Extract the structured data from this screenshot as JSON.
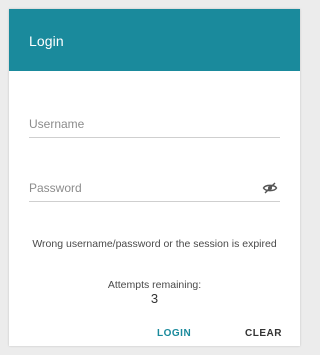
{
  "header": {
    "title": "Login",
    "background": "#1a8a9c"
  },
  "form": {
    "username": {
      "placeholder": "Username",
      "value": ""
    },
    "password": {
      "placeholder": "Password",
      "value": "",
      "toggle_icon": "eye-slash-icon"
    }
  },
  "message": {
    "error": "Wrong username/password or the session is expired",
    "attempts_label": "Attempts remaining:",
    "attempts_count": "3"
  },
  "actions": {
    "login_label": "LOGIN",
    "clear_label": "CLEAR",
    "accent": "#1a8a9c"
  }
}
